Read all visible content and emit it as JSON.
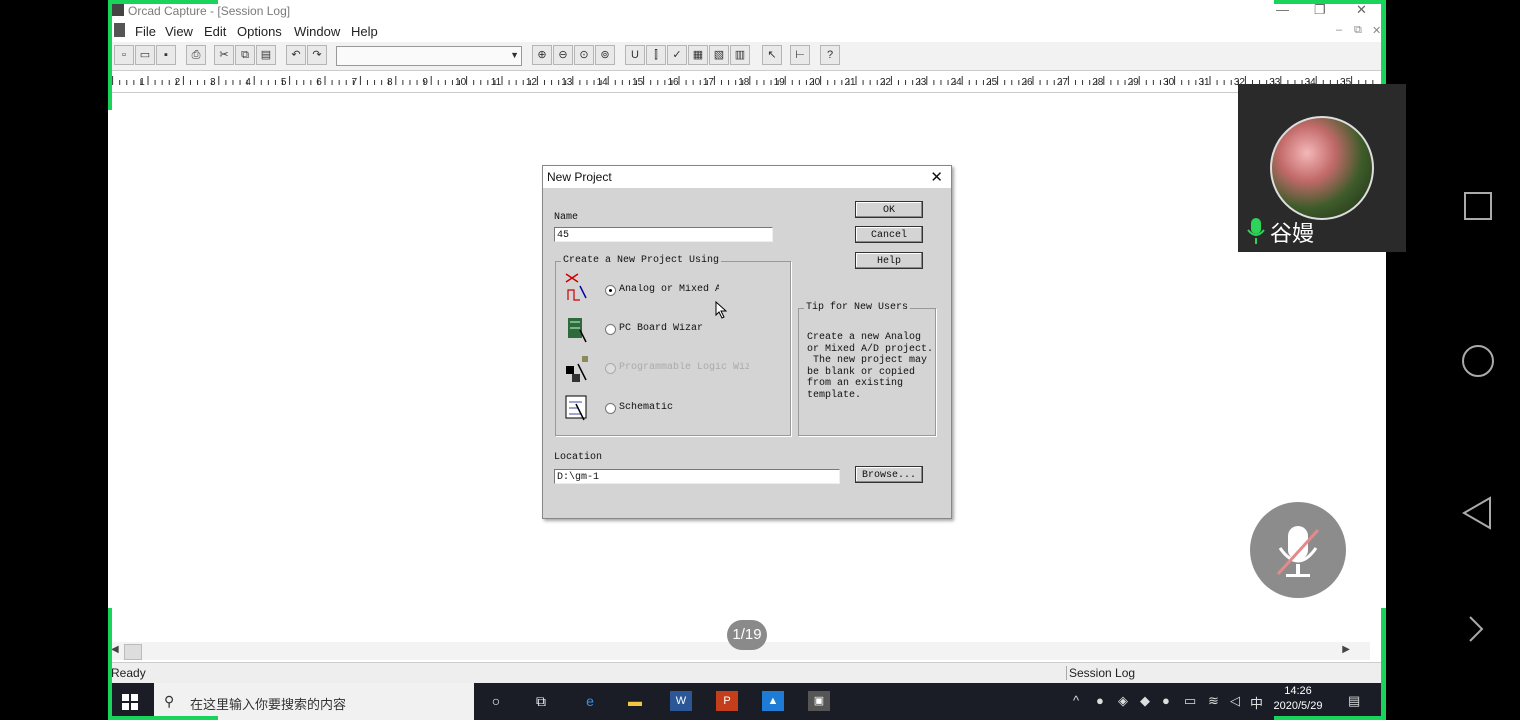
{
  "window": {
    "title": "Orcad Capture - [Session Log]",
    "controls": [
      "—",
      "❐",
      "✕"
    ]
  },
  "menu": {
    "items": [
      "File",
      "View",
      "Edit",
      "Options",
      "Window",
      "Help"
    ],
    "mdi_controls": [
      "–",
      "⧉",
      "✕"
    ]
  },
  "ruler": {
    "labels": [
      "1",
      "2",
      "3",
      "4",
      "5",
      "6",
      "7",
      "8",
      "9",
      "10",
      "11",
      "12",
      "13",
      "14",
      "15",
      "16",
      "17",
      "18",
      "19",
      "20",
      "21",
      "22",
      "23",
      "24",
      "25",
      "26",
      "27",
      "28",
      "29",
      "30",
      "31",
      "32",
      "33",
      "34",
      "35"
    ]
  },
  "dialog": {
    "title": "New Project",
    "close": "✕",
    "name_label": "Name",
    "name_value": "45",
    "group_label": "Create a New Project Using",
    "options": [
      {
        "label": "Analog or Mixed A/",
        "selected": true,
        "enabled": true
      },
      {
        "label": "PC Board Wizard",
        "selected": false,
        "enabled": true
      },
      {
        "label": "Programmable Logic Wiz",
        "selected": false,
        "enabled": false
      },
      {
        "label": "Schematic",
        "selected": false,
        "enabled": true
      }
    ],
    "tip_label": "Tip for New Users",
    "tip_text": "Create a new Analog\nor Mixed A/D project.\n The new project may\nbe blank or copied\nfrom an existing\ntemplate.",
    "location_label": "Location",
    "location_value": "D:\\gm-1",
    "buttons": {
      "ok": "OK",
      "cancel": "Cancel",
      "help": "Help",
      "browse": "Browse..."
    }
  },
  "status": {
    "left": "Ready",
    "right": "Session Log"
  },
  "taskbar": {
    "search_placeholder": "在这里输入你要搜索的内容",
    "ime": "中",
    "time": "14:26",
    "date": "2020/5/29"
  },
  "overlay": {
    "participant_name": "谷嫚",
    "page_indicator": "1/19"
  },
  "colors": {
    "border_green": "#19d45b",
    "taskbar": "#1a1d26",
    "dialog_bg": "#d4d4d4"
  }
}
